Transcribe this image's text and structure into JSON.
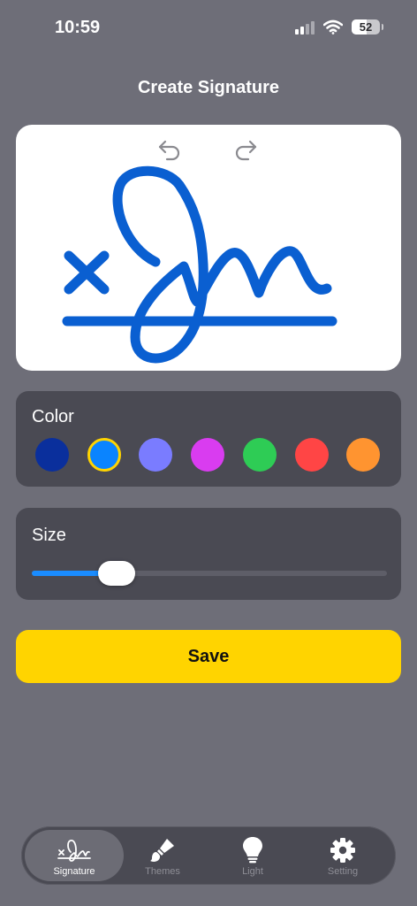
{
  "status_bar": {
    "time": "10:59",
    "battery": "52",
    "battery_level": 0.52
  },
  "header": {
    "title": "Create Signature"
  },
  "canvas": {
    "undo_icon": "undo-arrow-icon",
    "redo_icon": "redo-arrow-icon",
    "ink_color": "#0a5fd1",
    "background": "#ffffff"
  },
  "color_panel": {
    "title": "Color",
    "selected_index": 1,
    "swatches": [
      "#0a2f9c",
      "#0a84ff",
      "#7a7cff",
      "#d93cf0",
      "#2ecc55",
      "#ff4545",
      "#ff9430"
    ]
  },
  "size_panel": {
    "title": "Size",
    "value": 0.24
  },
  "save_button": {
    "label": "Save",
    "color": "#ffd400"
  },
  "tab_bar": {
    "tabs": [
      {
        "label": "Signature",
        "icon": "signature-icon",
        "active": true
      },
      {
        "label": "Themes",
        "icon": "paintbrush-icon",
        "active": false
      },
      {
        "label": "Light",
        "icon": "lightbulb-icon",
        "active": false
      },
      {
        "label": "Setting",
        "icon": "gear-icon",
        "active": false
      }
    ]
  }
}
